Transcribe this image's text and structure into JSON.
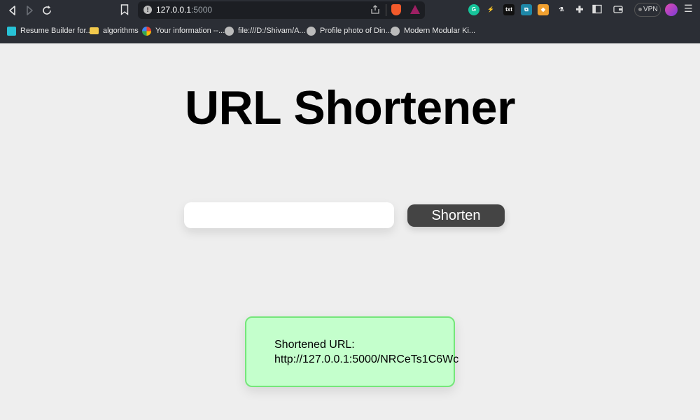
{
  "browser": {
    "address": {
      "host": "127.0.0.1",
      "port": ":5000"
    },
    "vpn_label": "VPN",
    "extensions": [
      {
        "name": "grammarly-icon",
        "label": "G",
        "color": "#15c39a"
      },
      {
        "name": "bolt-icon",
        "label": "⚡",
        "color": "#2b2e35"
      },
      {
        "name": "txt-icon",
        "label": "txt",
        "color": "#111111"
      },
      {
        "name": "bookmark-ext-icon",
        "label": "⧉",
        "color": "#1e88a8"
      },
      {
        "name": "shield-ext-icon",
        "label": "◆",
        "color": "#f0a030"
      },
      {
        "name": "chart-ext-icon",
        "label": "⚗",
        "color": "#2b2e35"
      }
    ],
    "bookmarks": [
      {
        "label": "Resume Builder for...",
        "icon": "n-logo-icon",
        "color": "#27c2d6"
      },
      {
        "label": "algorithms",
        "icon": "folder-icon",
        "color": "#f2c94c"
      },
      {
        "label": "Your information --...",
        "icon": "google-icon",
        "color": "#ffffff"
      },
      {
        "label": "file:///D:/Shivam/A...",
        "icon": "globe-icon",
        "color": "#bbbbbb"
      },
      {
        "label": "Profile photo of Din...",
        "icon": "globe-icon",
        "color": "#bbbbbb"
      },
      {
        "label": "Modern Modular Ki...",
        "icon": "globe-icon",
        "color": "#bbbbbb"
      }
    ]
  },
  "page": {
    "title": "URL Shortener",
    "input": {
      "value": "",
      "placeholder": ""
    },
    "shorten_label": "Shorten",
    "result": {
      "label": "Shortened URL:",
      "link": "http://127.0.0.1:5000/NRCeTs1C6Wc"
    }
  },
  "colors": {
    "page_bg": "#eeeeee",
    "button_bg": "#444444",
    "result_bg": "#c4ffcc",
    "result_border": "#75e67a"
  }
}
